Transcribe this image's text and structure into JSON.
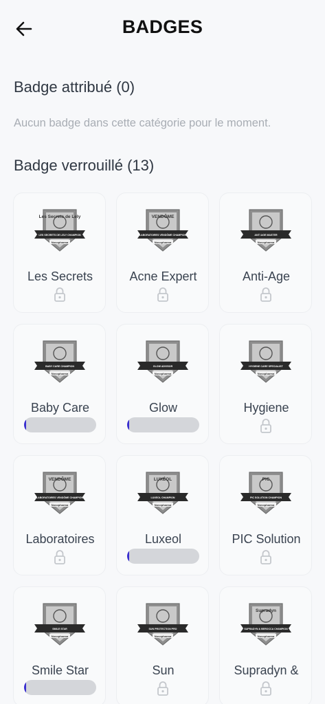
{
  "header": {
    "title": "BADGES",
    "back_icon": "arrow-left-icon"
  },
  "awarded": {
    "title": "Badge attribué (0)",
    "empty_message": "Aucun badge dans cette catégorie pour le moment."
  },
  "locked": {
    "title": "Badge verrouillé (13)"
  },
  "colors": {
    "progress_fill": "#3a2fd0",
    "progress_track": "#d4d6da",
    "badge_gray": "#8e8e8e",
    "ribbon": "#2a2a2a"
  },
  "badges": [
    {
      "name": "Les Secrets",
      "emblem_top": "Les Secrets de Lely",
      "ribbon": "LES SECRETS DE LELY CHAMPION",
      "status": "locked"
    },
    {
      "name": "Acne Expert",
      "emblem_top": "VENDÔME",
      "ribbon": "LABORATOIRES VENDÔME CHAMPION",
      "status": "locked"
    },
    {
      "name": "Anti-Age",
      "emblem_top": "",
      "ribbon": "ANTI AGE MASTER",
      "status": "locked"
    },
    {
      "name": "Baby Care",
      "emblem_top": "",
      "ribbon": "BABY CARE CHAMPION",
      "status": "progress",
      "progress": 0.03
    },
    {
      "name": "Glow",
      "emblem_top": "",
      "ribbon": "GLOW ADVISOR",
      "status": "progress",
      "progress": 0.03
    },
    {
      "name": "Hygiene",
      "emblem_top": "",
      "ribbon": "HYGIENE CARE SPECIALIST",
      "status": "locked"
    },
    {
      "name": "Laboratoires",
      "emblem_top": "VENDÔME",
      "ribbon": "LABORATOIRES VENDÔME CHAMPION",
      "status": "locked"
    },
    {
      "name": "Luxeol",
      "emblem_top": "LUXÉOL",
      "ribbon": "LUXEOL CHAMPION",
      "status": "progress",
      "progress": 0.03
    },
    {
      "name": "PIC Solution",
      "emblem_top": "PiC",
      "ribbon": "PIC SOLUTION CHAMPION",
      "status": "locked"
    },
    {
      "name": "Smile Star",
      "emblem_top": "",
      "ribbon": "SMILE STAR",
      "status": "progress",
      "progress": 0.03
    },
    {
      "name": "Sun",
      "emblem_top": "",
      "ribbon": "SUN PROTECTION PRO",
      "status": "locked"
    },
    {
      "name": "Supradyn &",
      "emblem_top": "Supradyn",
      "ribbon": "SUPRADYN & BEROCCA CHAMPION",
      "status": "locked"
    }
  ],
  "brand": "Novopharma"
}
